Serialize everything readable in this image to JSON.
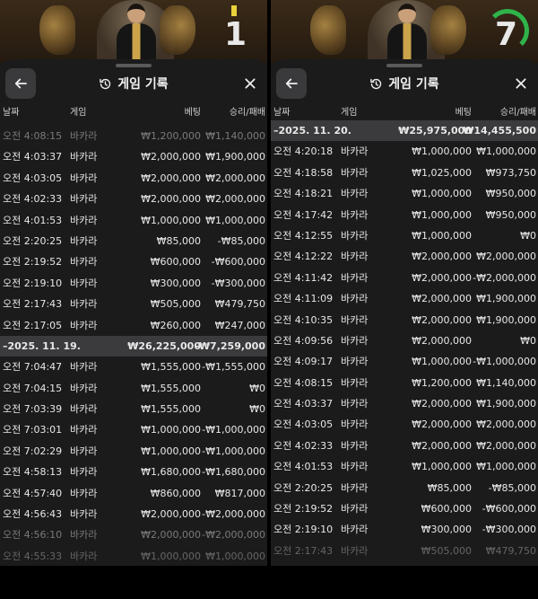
{
  "header": {
    "title": "게임 기록",
    "col_date": "날짜",
    "col_game": "게임",
    "col_bet": "베팅",
    "col_result": "승리/패배"
  },
  "colors": {
    "sheet_bg": "#1b1b1c",
    "summary_bg": "#3b3b3d",
    "button_bg": "#3a3a3c",
    "timer_green": "#2fb34a"
  },
  "left": {
    "round_number": "1",
    "rows": [
      {
        "date": "오전 4:08:15",
        "game": "바카라",
        "bet": "₩1,200,000",
        "result": "₩1,140,000",
        "style": "faded"
      },
      {
        "date": "오전 4:03:37",
        "game": "바카라",
        "bet": "₩2,000,000",
        "result": "₩1,900,000",
        "style": ""
      },
      {
        "date": "오전 4:03:05",
        "game": "바카라",
        "bet": "₩2,000,000",
        "result": "₩2,000,000",
        "style": ""
      },
      {
        "date": "오전 4:02:33",
        "game": "바카라",
        "bet": "₩2,000,000",
        "result": "₩2,000,000",
        "style": ""
      },
      {
        "date": "오전 4:01:53",
        "game": "바카라",
        "bet": "₩1,000,000",
        "result": "₩1,000,000",
        "style": ""
      },
      {
        "date": "오전 2:20:25",
        "game": "바카라",
        "bet": "₩85,000",
        "result": "-₩85,000",
        "style": ""
      },
      {
        "date": "오전 2:19:52",
        "game": "바카라",
        "bet": "₩600,000",
        "result": "-₩600,000",
        "style": ""
      },
      {
        "date": "오전 2:19:10",
        "game": "바카라",
        "bet": "₩300,000",
        "result": "-₩300,000",
        "style": ""
      },
      {
        "date": "오전 2:17:43",
        "game": "바카라",
        "bet": "₩505,000",
        "result": "₩479,750",
        "style": ""
      },
      {
        "date": "오전 2:17:05",
        "game": "바카라",
        "bet": "₩260,000",
        "result": "₩247,000",
        "style": ""
      },
      {
        "date": "–2025. 11. 19.",
        "game": "",
        "bet": "₩26,225,000",
        "result": "-₩7,259,000",
        "style": "summary"
      },
      {
        "date": "오전 7:04:47",
        "game": "바카라",
        "bet": "₩1,555,000",
        "result": "-₩1,555,000",
        "style": ""
      },
      {
        "date": "오전 7:04:15",
        "game": "바카라",
        "bet": "₩1,555,000",
        "result": "₩0",
        "style": ""
      },
      {
        "date": "오전 7:03:39",
        "game": "바카라",
        "bet": "₩1,555,000",
        "result": "₩0",
        "style": ""
      },
      {
        "date": "오전 7:03:01",
        "game": "바카라",
        "bet": "₩1,000,000",
        "result": "-₩1,000,000",
        "style": ""
      },
      {
        "date": "오전 7:02:29",
        "game": "바카라",
        "bet": "₩1,000,000",
        "result": "-₩1,000,000",
        "style": ""
      },
      {
        "date": "오전 4:58:13",
        "game": "바카라",
        "bet": "₩1,680,000",
        "result": "-₩1,680,000",
        "style": ""
      },
      {
        "date": "오전 4:57:40",
        "game": "바카라",
        "bet": "₩860,000",
        "result": "₩817,000",
        "style": ""
      },
      {
        "date": "오전 4:56:43",
        "game": "바카라",
        "bet": "₩2,000,000",
        "result": "-₩2,000,000",
        "style": ""
      },
      {
        "date": "오전 4:56:10",
        "game": "바카라",
        "bet": "₩2,000,000",
        "result": "-₩2,000,000",
        "style": "faded"
      },
      {
        "date": "오전 4:55:33",
        "game": "바카라",
        "bet": "₩1,000,000",
        "result": "₩1,000,000",
        "style": "fade-more"
      }
    ]
  },
  "right": {
    "round_number": "7",
    "rows": [
      {
        "date": "–2025. 11. 20.",
        "game": "",
        "bet": "₩25,975,000",
        "result": "₩14,455,500",
        "style": "summary"
      },
      {
        "date": "오전 4:20:18",
        "game": "바카라",
        "bet": "₩1,000,000",
        "result": "₩1,000,000",
        "style": ""
      },
      {
        "date": "오전 4:18:58",
        "game": "바카라",
        "bet": "₩1,025,000",
        "result": "₩973,750",
        "style": ""
      },
      {
        "date": "오전 4:18:21",
        "game": "바카라",
        "bet": "₩1,000,000",
        "result": "₩950,000",
        "style": ""
      },
      {
        "date": "오전 4:17:42",
        "game": "바카라",
        "bet": "₩1,000,000",
        "result": "₩950,000",
        "style": ""
      },
      {
        "date": "오전 4:12:55",
        "game": "바카라",
        "bet": "₩1,000,000",
        "result": "₩0",
        "style": ""
      },
      {
        "date": "오전 4:12:22",
        "game": "바카라",
        "bet": "₩2,000,000",
        "result": "₩2,000,000",
        "style": ""
      },
      {
        "date": "오전 4:11:42",
        "game": "바카라",
        "bet": "₩2,000,000",
        "result": "-₩2,000,000",
        "style": ""
      },
      {
        "date": "오전 4:11:09",
        "game": "바카라",
        "bet": "₩2,000,000",
        "result": "₩1,900,000",
        "style": ""
      },
      {
        "date": "오전 4:10:35",
        "game": "바카라",
        "bet": "₩2,000,000",
        "result": "₩1,900,000",
        "style": ""
      },
      {
        "date": "오전 4:09:56",
        "game": "바카라",
        "bet": "₩2,000,000",
        "result": "₩0",
        "style": ""
      },
      {
        "date": "오전 4:09:17",
        "game": "바카라",
        "bet": "₩1,000,000",
        "result": "-₩1,000,000",
        "style": ""
      },
      {
        "date": "오전 4:08:15",
        "game": "바카라",
        "bet": "₩1,200,000",
        "result": "₩1,140,000",
        "style": ""
      },
      {
        "date": "오전 4:03:37",
        "game": "바카라",
        "bet": "₩2,000,000",
        "result": "₩1,900,000",
        "style": ""
      },
      {
        "date": "오전 4:03:05",
        "game": "바카라",
        "bet": "₩2,000,000",
        "result": "₩2,000,000",
        "style": ""
      },
      {
        "date": "오전 4:02:33",
        "game": "바카라",
        "bet": "₩2,000,000",
        "result": "₩2,000,000",
        "style": ""
      },
      {
        "date": "오전 4:01:53",
        "game": "바카라",
        "bet": "₩1,000,000",
        "result": "₩1,000,000",
        "style": ""
      },
      {
        "date": "오전 2:20:25",
        "game": "바카라",
        "bet": "₩85,000",
        "result": "-₩85,000",
        "style": ""
      },
      {
        "date": "오전 2:19:52",
        "game": "바카라",
        "bet": "₩600,000",
        "result": "-₩600,000",
        "style": ""
      },
      {
        "date": "오전 2:19:10",
        "game": "바카라",
        "bet": "₩300,000",
        "result": "-₩300,000",
        "style": ""
      },
      {
        "date": "오전 2:17:43",
        "game": "바카라",
        "bet": "₩505,000",
        "result": "₩479,750",
        "style": "fade-more"
      }
    ]
  }
}
